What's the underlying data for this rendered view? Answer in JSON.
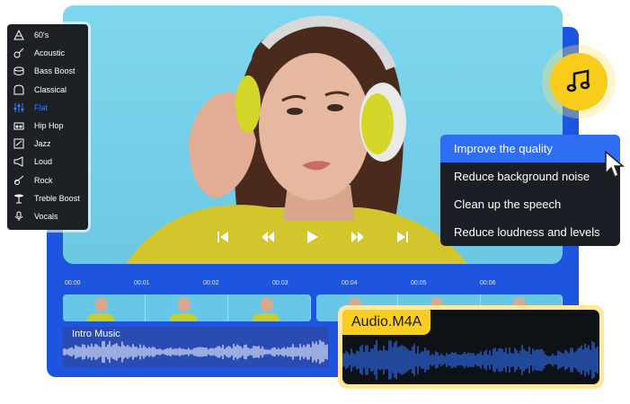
{
  "eq_menu": {
    "items": [
      {
        "label": "60's",
        "icon": "cone-icon"
      },
      {
        "label": "Acoustic",
        "icon": "guitar-icon"
      },
      {
        "label": "Bass Boost",
        "icon": "drum-icon"
      },
      {
        "label": "Classical",
        "icon": "piano-icon"
      },
      {
        "label": "Flat",
        "icon": "equalizer-icon",
        "active": true
      },
      {
        "label": "Hip Hop",
        "icon": "boombox-icon"
      },
      {
        "label": "Jazz",
        "icon": "score-icon"
      },
      {
        "label": "Loud",
        "icon": "megaphone-icon"
      },
      {
        "label": "Rock",
        "icon": "electric-guitar-icon"
      },
      {
        "label": "Treble Boost",
        "icon": "cymbal-icon"
      },
      {
        "label": "Vocals",
        "icon": "microphone-icon"
      }
    ],
    "active_color": "#3c7dff"
  },
  "quality_menu": {
    "items": [
      "Improve the quality",
      "Reduce background noise",
      "Clean up the speech",
      "Reduce loudness and levels"
    ],
    "active_index": 0,
    "active_color": "#2f6df2"
  },
  "player": {
    "controls": [
      "skip-back-icon",
      "rewind-icon",
      "play-icon",
      "fast-forward-icon",
      "skip-forward-icon"
    ]
  },
  "timeline": {
    "ticks": [
      "00:00",
      "00:01",
      "00:02",
      "00:03",
      "00:04",
      "00:05",
      "00:06"
    ]
  },
  "audio_track": {
    "label": "Intro Music"
  },
  "audio_card": {
    "title": "Audio.M4A"
  },
  "colors": {
    "panel": "#1d55e0",
    "accent_yellow": "#f8cf21"
  }
}
